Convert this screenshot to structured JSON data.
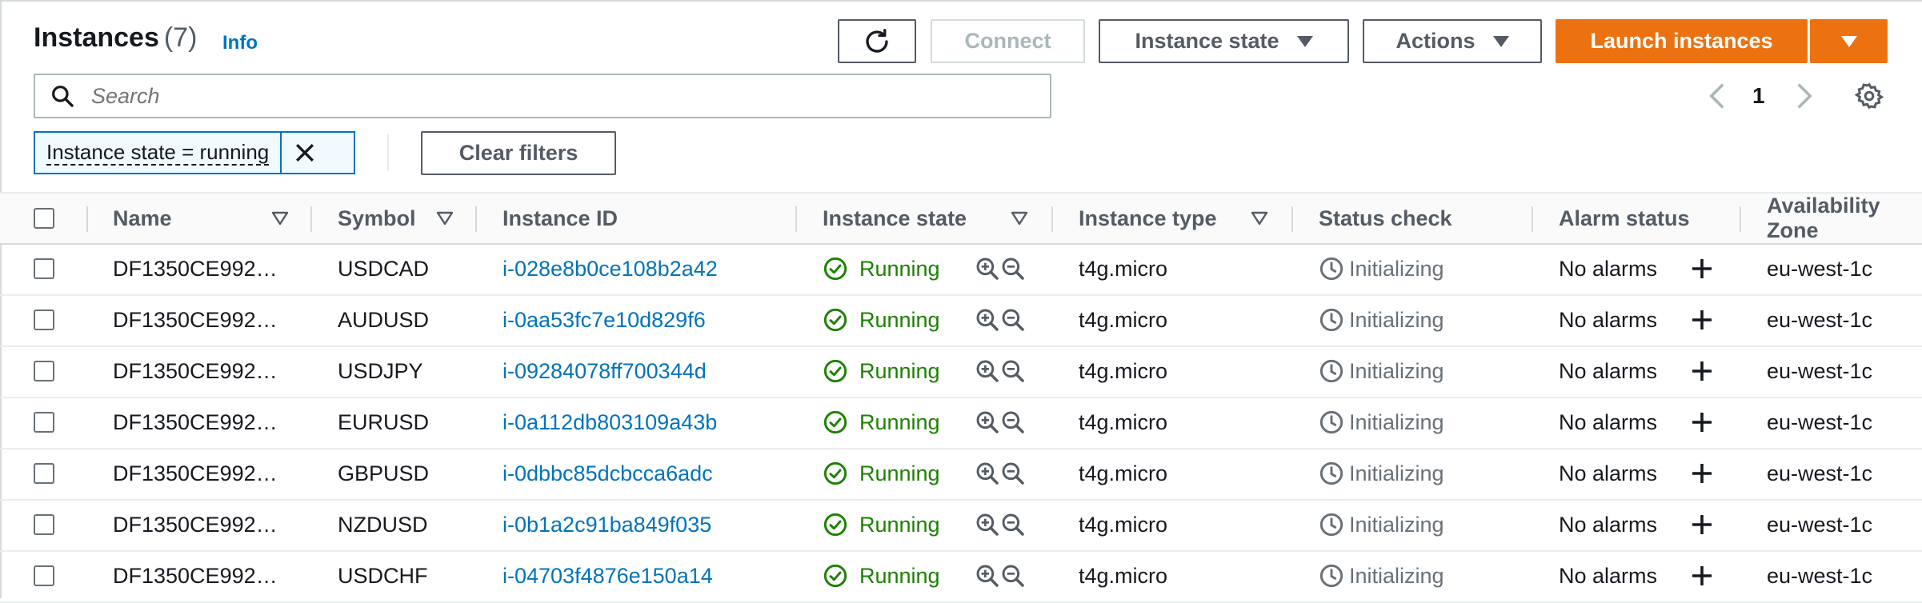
{
  "header": {
    "title": "Instances",
    "count": "(7)",
    "info_link": "Info",
    "connect_label": "Connect",
    "instance_state_label": "Instance state",
    "actions_label": "Actions",
    "launch_label": "Launch instances"
  },
  "search": {
    "placeholder": "Search"
  },
  "pagination": {
    "current_page": "1"
  },
  "filter": {
    "chip_label": "Instance state = running",
    "clear_label": "Clear filters"
  },
  "table": {
    "columns": [
      "Name",
      "Symbol",
      "Instance ID",
      "Instance state",
      "Instance type",
      "Status check",
      "Alarm status",
      "Availability Zone"
    ],
    "rows": [
      {
        "name": "DF1350CE992…",
        "symbol": "USDCAD",
        "id": "i-028e8b0ce108b2a42",
        "state": "Running",
        "type": "t4g.micro",
        "status": "Initializing",
        "alarm": "No alarms",
        "az": "eu-west-1c"
      },
      {
        "name": "DF1350CE992…",
        "symbol": "AUDUSD",
        "id": "i-0aa53fc7e10d829f6",
        "state": "Running",
        "type": "t4g.micro",
        "status": "Initializing",
        "alarm": "No alarms",
        "az": "eu-west-1c"
      },
      {
        "name": "DF1350CE992…",
        "symbol": "USDJPY",
        "id": "i-09284078ff700344d",
        "state": "Running",
        "type": "t4g.micro",
        "status": "Initializing",
        "alarm": "No alarms",
        "az": "eu-west-1c"
      },
      {
        "name": "DF1350CE992…",
        "symbol": "EURUSD",
        "id": "i-0a112db803109a43b",
        "state": "Running",
        "type": "t4g.micro",
        "status": "Initializing",
        "alarm": "No alarms",
        "az": "eu-west-1c"
      },
      {
        "name": "DF1350CE992…",
        "symbol": "GBPUSD",
        "id": "i-0dbbc85dcbcca6adc",
        "state": "Running",
        "type": "t4g.micro",
        "status": "Initializing",
        "alarm": "No alarms",
        "az": "eu-west-1c"
      },
      {
        "name": "DF1350CE992…",
        "symbol": "NZDUSD",
        "id": "i-0b1a2c91ba849f035",
        "state": "Running",
        "type": "t4g.micro",
        "status": "Initializing",
        "alarm": "No alarms",
        "az": "eu-west-1c"
      },
      {
        "name": "DF1350CE992…",
        "symbol": "USDCHF",
        "id": "i-04703f4876e150a14",
        "state": "Running",
        "type": "t4g.micro",
        "status": "Initializing",
        "alarm": "No alarms",
        "az": "eu-west-1c"
      }
    ]
  },
  "icons": {
    "refresh": "refresh-icon",
    "settings": "gear-icon",
    "running": "check-circle-icon",
    "status": "clock-icon",
    "zoom_in": "zoom-in-icon",
    "zoom_out": "zoom-out-icon",
    "add_alarm": "plus-icon",
    "sort": "sort-triangle-icon"
  },
  "colors": {
    "accent": "#ec7211",
    "link": "#0073bb",
    "running": "#1d8102",
    "muted": "#687078"
  }
}
